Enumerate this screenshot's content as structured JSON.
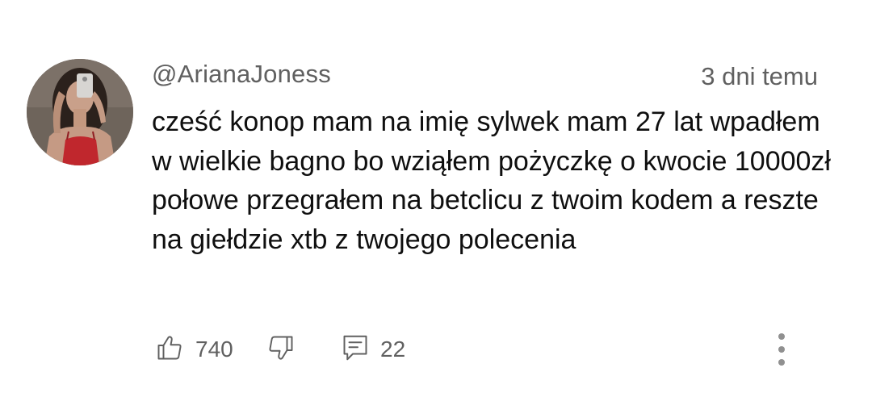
{
  "comment": {
    "author": "@ArianaJoness",
    "timestamp": "3 dni temu",
    "text": "cześć konop mam na imię sylwek mam 27 lat wpadłem w wielkie bagno bo wziąłem pożyczkę o kwocie 10000zł połowe przegrałem na betclicu z twoim kodem a reszte na giełdzie xtb z twojego polecenia"
  },
  "actions": {
    "like_count": "740",
    "reply_count": "22",
    "icons": {
      "like": "thumbs-up-icon",
      "dislike": "thumbs-down-icon",
      "reply": "comment-icon",
      "more": "more-vertical-icon"
    }
  },
  "colors": {
    "text_primary": "#0f0f0f",
    "text_secondary": "#606060",
    "icon": "#606060",
    "more_dots": "#909090"
  }
}
